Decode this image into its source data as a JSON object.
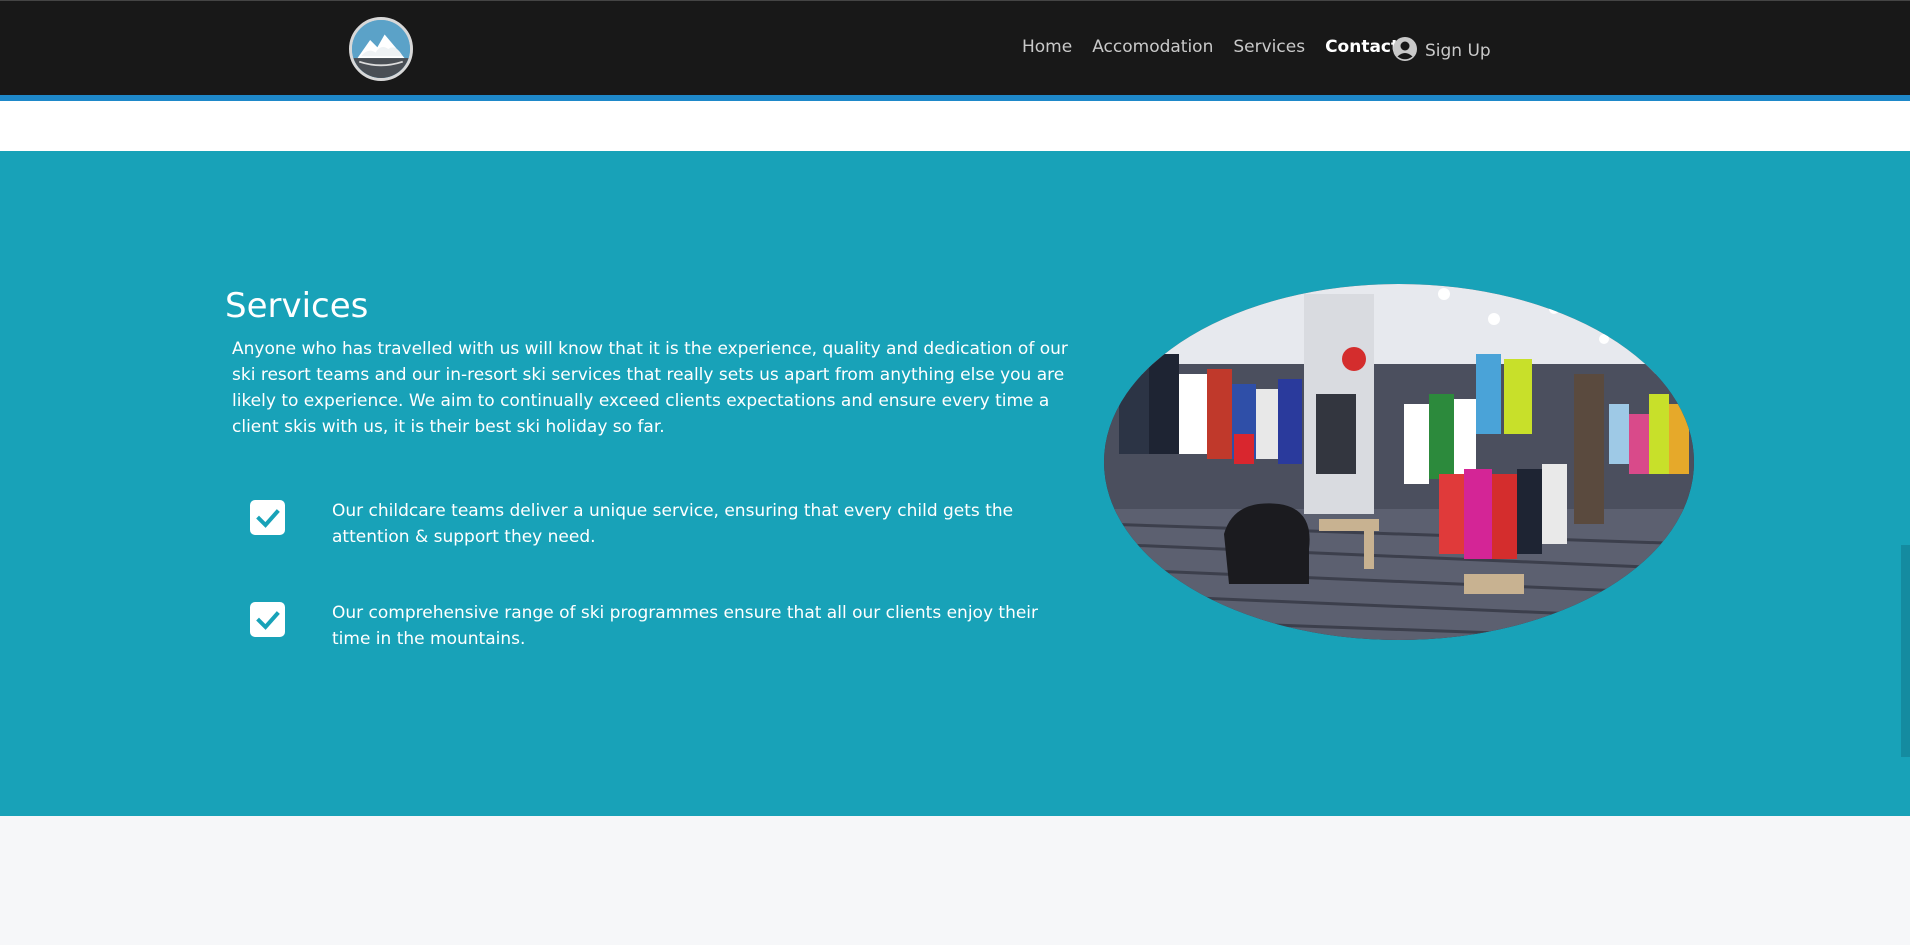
{
  "navbar": {
    "logo_icon": "mountain-logo-icon",
    "links": [
      {
        "label": "Home",
        "active": false
      },
      {
        "label": "Accomodation",
        "active": false
      },
      {
        "label": "Services",
        "active": false
      },
      {
        "label": "Contact",
        "active": true
      }
    ],
    "signup": {
      "label": "Sign Up",
      "icon": "user-circle-icon"
    },
    "colors": {
      "background": "#181818",
      "accent": "#1e88c9"
    }
  },
  "services": {
    "title": "Services",
    "intro": "Anyone who has travelled with us will know that it is the experience, quality and dedication of our ski resort teams and our in-resort ski services that really sets us apart from anything else you are likely to experience. We aim to continually exceed clients expectations and ensure every time a client skis with us, it is their best ski holiday so far.",
    "features": [
      {
        "icon": "checkbox-icon",
        "text": "Our childcare teams deliver a unique service, ensuring that every child gets the attention & support they need."
      },
      {
        "icon": "checkbox-icon",
        "text": "Our comprehensive range of ski programmes ensure that all our clients enjoy their time in the mountains."
      }
    ],
    "image": "ski-store-photo",
    "colors": {
      "background": "#18a2b8",
      "text": "#ffffff"
    }
  }
}
